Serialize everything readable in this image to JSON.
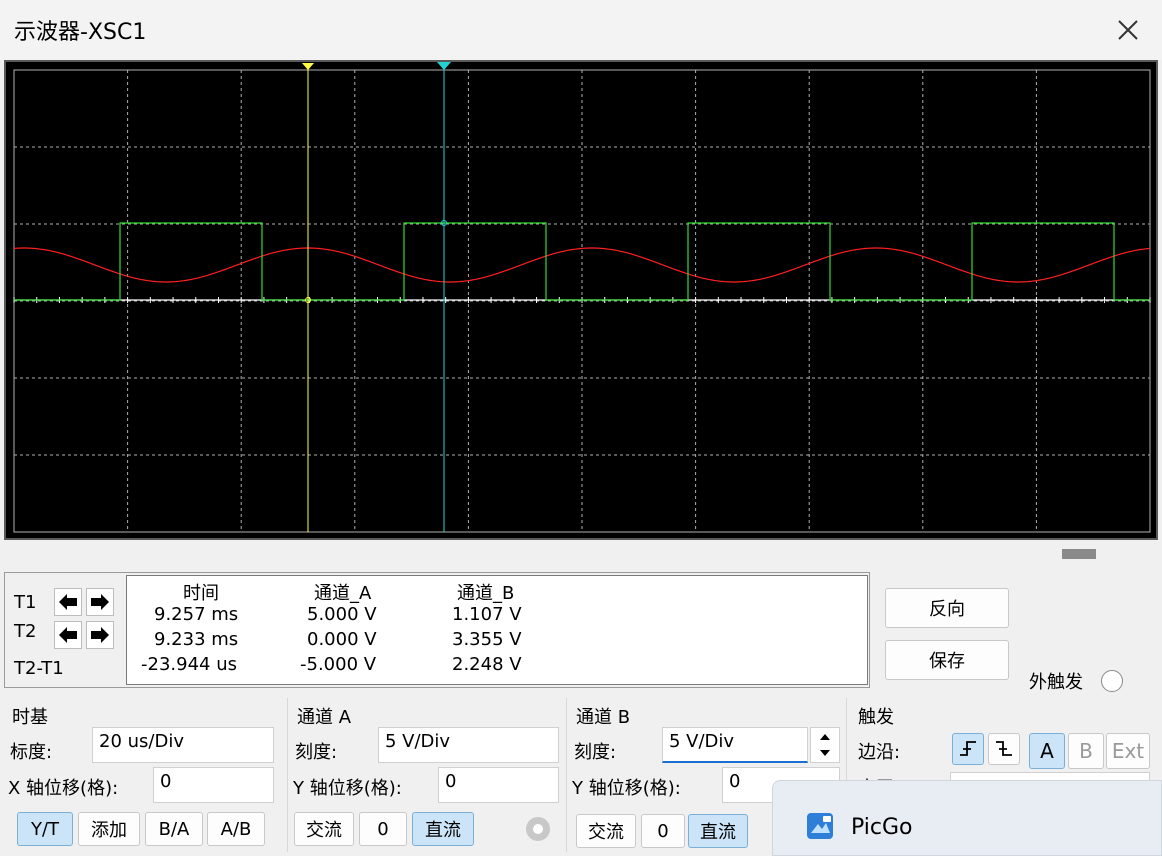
{
  "window": {
    "title": "示波器-XSC1"
  },
  "colors": {
    "grid": "#b0b0b0",
    "channelA": "#ff2020",
    "channelB": "#33dd33",
    "cursor1": "#ffff44",
    "cursor2": "#22d3d3"
  },
  "readout": {
    "row_labels": [
      "T1",
      "T2",
      "T2-T1"
    ],
    "headers": {
      "time": "时间",
      "a": "通道_A",
      "b": "通道_B"
    },
    "rows": [
      {
        "time": "9.257 ms",
        "a": "5.000 V",
        "b": "1.107 V"
      },
      {
        "time": "9.233 ms",
        "a": "0.000 V",
        "b": "3.355 V"
      },
      {
        "time": "-23.944 us",
        "a": "-5.000 V",
        "b": "2.248 V"
      }
    ]
  },
  "buttons": {
    "reverse": "反向",
    "save": "保存",
    "ext_trigger": "外触发"
  },
  "timebase": {
    "title": "时基",
    "scale_label": "标度:",
    "scale_value": "20 us/Div",
    "xpos_label": "X 轴位移(格):",
    "xpos_value": "0",
    "modes": [
      "Y/T",
      "添加",
      "B/A",
      "A/B"
    ],
    "active_mode": "Y/T"
  },
  "channelA": {
    "title": "通道 A",
    "scale_label": "刻度:",
    "scale_value": "5  V/Div",
    "ypos_label": "Y 轴位移(格):",
    "ypos_value": "0",
    "coupling": [
      "交流",
      "0",
      "直流"
    ],
    "active": "直流"
  },
  "channelB": {
    "title": "通道 B",
    "scale_label": "刻度:",
    "scale_value": "5  V/Div",
    "ypos_label": "Y 轴位移(格):",
    "ypos_value": "0",
    "coupling": [
      "交流",
      "0",
      "直流"
    ],
    "active": "直流"
  },
  "trigger": {
    "title": "触发",
    "edge_label": "边沿:",
    "sources": [
      "A",
      "B",
      "Ext"
    ],
    "active_source": "A",
    "level_label": "水平:"
  },
  "toast": {
    "app": "PicGo"
  }
}
